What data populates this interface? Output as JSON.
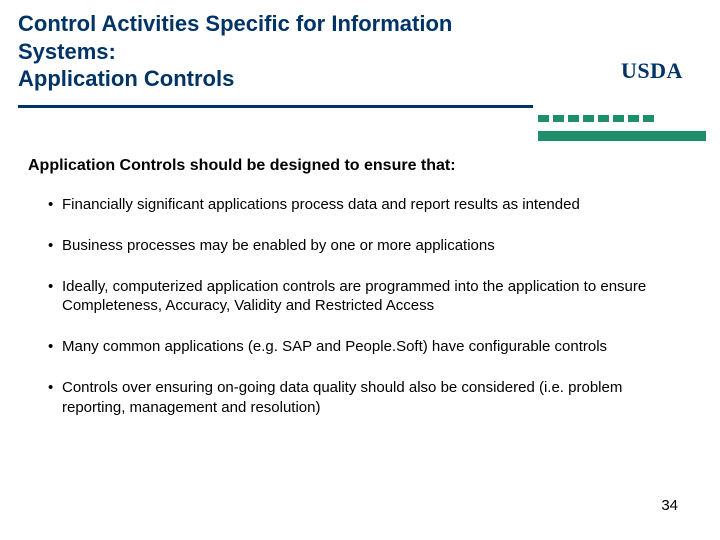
{
  "title_line1": "Control Activities Specific for Information Systems:",
  "title_line2": "Application Controls",
  "logo_text": "USDA",
  "subhead": "Application Controls should be designed to ensure that:",
  "bullets": [
    "Financially significant applications process data and report results as intended",
    "Business processes may be enabled by one or more applications",
    "Ideally, computerized application controls are programmed into the application to ensure Completeness, Accuracy, Validity and Restricted Access",
    "Many common applications (e.g. SAP and People.Soft) have configurable controls",
    "Controls over ensuring on-going data quality should also be considered (i.e. problem reporting, management and resolution)"
  ],
  "page_number": "34"
}
